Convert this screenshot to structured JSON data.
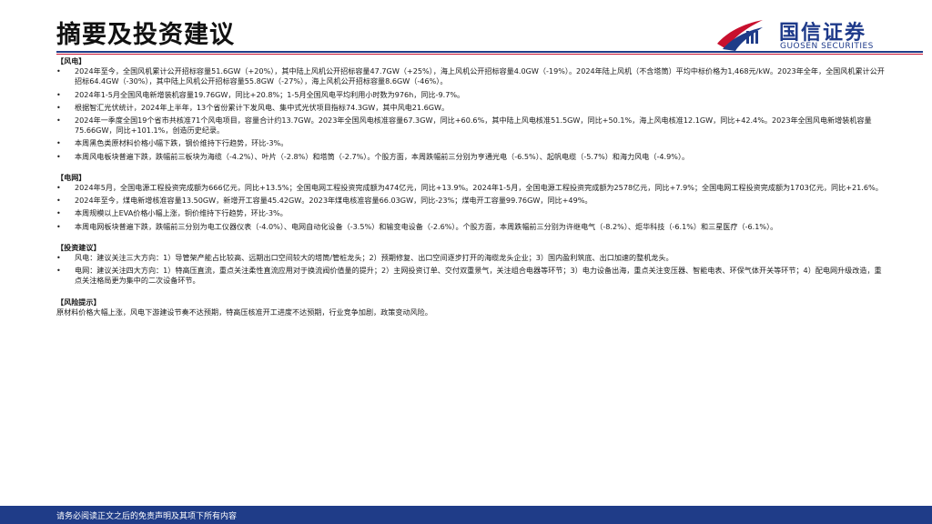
{
  "page": {
    "title": "摘要及投资建议"
  },
  "brand": {
    "name_cn": "国信证券",
    "name_en": "GUOSEN SECURITIES"
  },
  "sections": {
    "wind": {
      "heading": "【风电】",
      "items": [
        "2024年至今，全国风机累计公开招标容量51.6GW（+20%），其中陆上风机公开招标容量47.7GW（+25%），海上风机公开招标容量4.0GW（-19%）。2024年陆上风机（不含塔筒）平均中标价格为1,468元/kW。2023年全年，全国风机累计公开招标64.4GW（-30%），其中陆上风机公开招标容量55.8GW（-27%），海上风机公开招标容量8.6GW（-46%）。",
        "2024年1-5月全国风电新增装机容量19.76GW，同比+20.8%；1-5月全国风电平均利用小时数为976h，同比-9.7%。",
        "根据智汇光伏统计，2024年上半年，13个省份累计下发风电、集中式光伏项目指标74.3GW，其中风电21.6GW。",
        "2024年一季度全国19个省市共核准71个风电项目，容量合计约13.7GW。2023年全国风电核准容量67.3GW，同比+60.6%，其中陆上风电核准51.5GW，同比+50.1%，海上风电核准12.1GW，同比+42.4%。2023年全国风电新增装机容量75.66GW，同比+101.1%，创造历史纪录。",
        "本周黑色类原材料价格小幅下跌，钢价维持下行趋势，环比-3%。",
        "本周风电板块普遍下跌，跌幅前三板块为海缆（-4.2%）、叶片（-2.8%）和塔筒（-2.7%）。个股方面，本周跌幅前三分别为亨通光电（-6.5%）、起帆电缆（-5.7%）和海力风电（-4.9%）。"
      ]
    },
    "grid": {
      "heading": "【电网】",
      "items": [
        "2024年5月，全国电源工程投资完成额为666亿元，同比+13.5%；全国电网工程投资完成额为474亿元，同比+13.9%。2024年1-5月，全国电源工程投资完成额为2578亿元，同比+7.9%；全国电网工程投资完成额为1703亿元，同比+21.6%。",
        "2024年至今，煤电新增核准容量13.50GW，新增开工容量45.42GW。2023年煤电核准容量66.03GW，同比-23%；煤电开工容量99.76GW，同比+49%。",
        "本周规模以上EVA价格小幅上涨，铜价维持下行趋势，环比-3%。",
        "本周电网板块普遍下跌，跌幅前三分别为电工仪器仪表（-4.0%）、电网自动化设备（-3.5%）和输变电设备（-2.6%）。个股方面，本周跌幅前三分别为许继电气（-8.2%）、炬华科技（-6.1%）和三星医疗（-6.1%）。"
      ]
    },
    "advice": {
      "heading": "【投资建议】",
      "items": [
        "风电：建议关注三大方向：1）导管架产能占比较高、远期出口空间较大的塔筒/管桩龙头；2）预期修复、出口空间逐步打开的海缆龙头企业；3）国内盈利筑底、出口加速的整机龙头。",
        "电网：建议关注四大方向：1）特高压直流，重点关注柔性直流应用对于换流阀价值量的提升；2）主网投资订单、交付双重景气，关注组合电器等环节；3）电力设备出海，重点关注变压器、智能电表、环保气体开关等环节；4）配电网升级改造，重点关注格局更为集中的二次设备环节。"
      ]
    },
    "risk": {
      "heading": "【风险提示】",
      "text": "原材料价格大幅上涨，风电下游建设节奏不达预期，特高压核准开工进度不达预期，行业竞争加剧，政策变动风险。"
    }
  },
  "footer": {
    "disclaimer": "请务必阅读正文之后的免责声明及其项下所有内容"
  },
  "colors": {
    "brand_blue": "#1f3c88",
    "brand_red": "#c8102e"
  }
}
